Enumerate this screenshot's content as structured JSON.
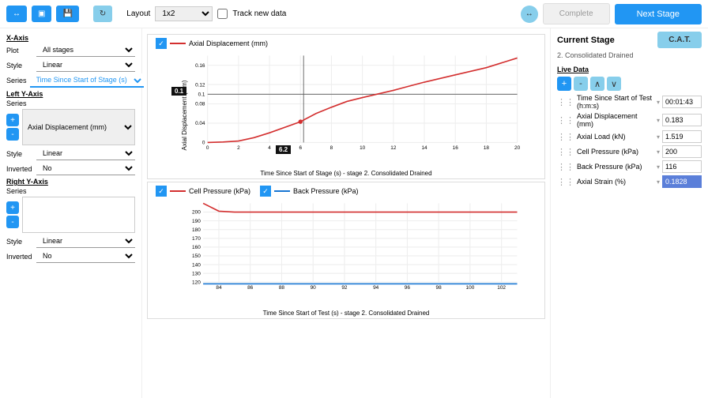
{
  "toolbar": {
    "layout_label": "Layout",
    "layout_value": "1x2",
    "track_label": "Track new data",
    "complete_label": "Complete",
    "next_label": "Next Stage"
  },
  "left": {
    "xaxis_title": "X-Axis",
    "plot_label": "Plot",
    "plot_value": "All stages",
    "style_label": "Style",
    "xstyle_value": "Linear",
    "series_label": "Series",
    "xseries_value": "Time Since Start of Stage (s)",
    "lefty_title": "Left Y-Axis",
    "lefty_series": "Axial Displacement (mm)",
    "lefty_style": "Linear",
    "inverted_label": "Inverted",
    "inverted_value": "No",
    "righty_title": "Right Y-Axis",
    "righty_style": "Linear",
    "righty_inverted": "No"
  },
  "right": {
    "current_title": "Current Stage",
    "cat_label": "C.A.T.",
    "stage_sub": "2. Consolidated Drained",
    "live_title": "Live Data",
    "rows": [
      {
        "label": "Time Since Start of Test (h:m:s)",
        "value": "00:01:43"
      },
      {
        "label": "Axial Displacement (mm)",
        "value": "0.183"
      },
      {
        "label": "Axial Load (kN)",
        "value": "1.519"
      },
      {
        "label": "Cell Pressure (kPa)",
        "value": "200"
      },
      {
        "label": "Back Pressure (kPa)",
        "value": "116"
      },
      {
        "label": "Axial Strain (%)",
        "value": "0.1828"
      }
    ]
  },
  "chart_data": [
    {
      "type": "line",
      "title": "",
      "xlabel": "Time Since Start of Stage (s) - stage 2. Consolidated Drained",
      "ylabel": "Axial Displacement (mm)",
      "xlim": [
        0,
        20
      ],
      "ylim": [
        0,
        0.18
      ],
      "yticks": [
        0,
        0.04,
        0.08,
        0.1,
        0.12,
        0.16
      ],
      "xticks": [
        0,
        2,
        4,
        6,
        8,
        10,
        12,
        14,
        16,
        18,
        20
      ],
      "series": [
        {
          "name": "Axial Displacement (mm)",
          "color": "#d32f2f",
          "x": [
            0,
            1,
            2,
            3,
            4,
            6,
            7,
            8,
            9,
            10,
            12,
            14,
            16,
            18,
            20
          ],
          "y": [
            0,
            0.001,
            0.003,
            0.01,
            0.02,
            0.043,
            0.06,
            0.073,
            0.085,
            0.093,
            0.108,
            0.125,
            0.14,
            0.155,
            0.175
          ]
        }
      ],
      "cursor": {
        "x": 6.2,
        "y": 0.1,
        "xlabel": "6.2",
        "ylabel": "0.1"
      }
    },
    {
      "type": "line",
      "title": "",
      "xlabel": "Time Since Start of Test (s) - stage 2. Consolidated Drained",
      "ylabel": "",
      "xlim": [
        83,
        103
      ],
      "ylim": [
        120,
        210
      ],
      "yticks": [
        120,
        130,
        140,
        150,
        160,
        170,
        180,
        190,
        200
      ],
      "xticks": [
        84,
        86,
        88,
        90,
        92,
        94,
        96,
        98,
        100,
        102
      ],
      "series": [
        {
          "name": "Cell Pressure (kPa)",
          "color": "#d32f2f",
          "x": [
            83,
            84,
            85,
            103
          ],
          "y": [
            210,
            201,
            200,
            200
          ]
        },
        {
          "name": "Back Pressure (kPa)",
          "color": "#1976d2",
          "x": [
            83,
            103
          ],
          "y": [
            118,
            118
          ]
        }
      ]
    }
  ]
}
